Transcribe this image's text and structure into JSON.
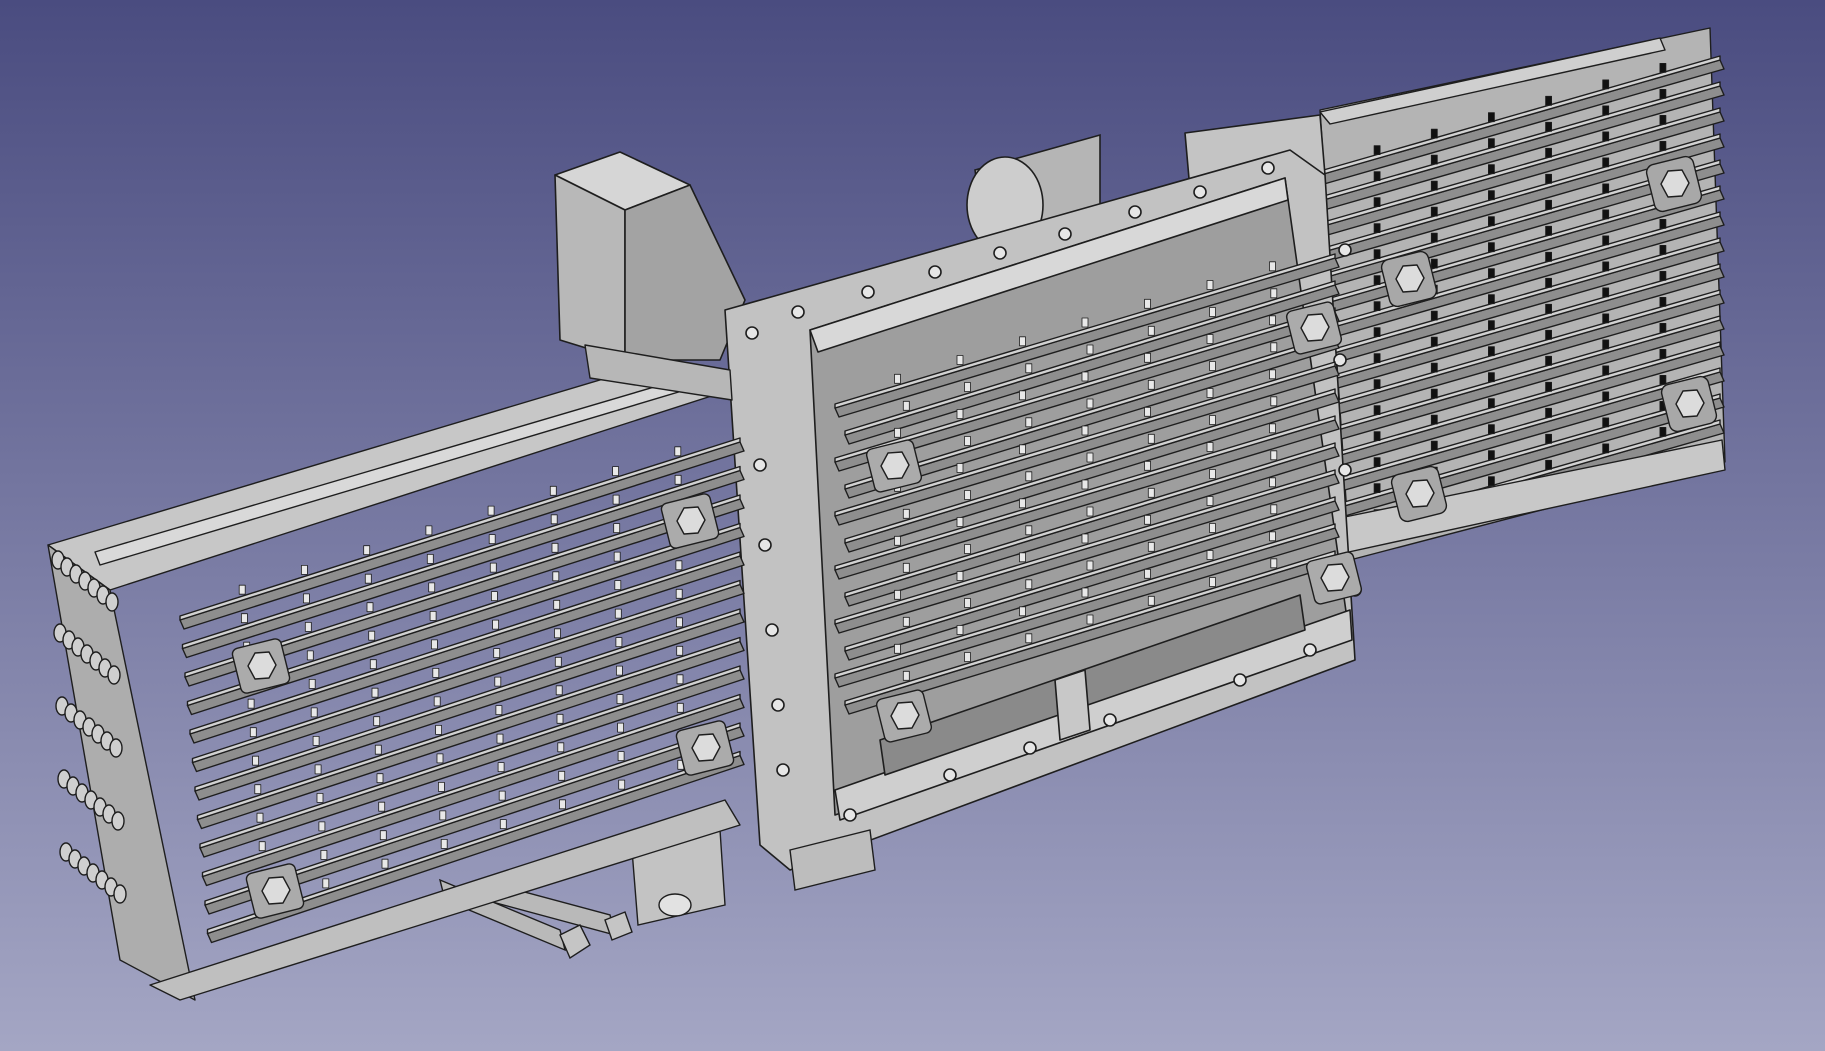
{
  "viewport": {
    "background_top": "#4a4c80",
    "background_bottom": "#a4a6c4",
    "model_fill": "#bdbdbd",
    "model_light": "#d2d2d2",
    "model_dark": "#8e8e8e",
    "edge_color": "#1e1e1e"
  },
  "model": {
    "parts": [
      "left-heatsink-stack",
      "center-heatsink-stack",
      "right-heatsink-stack",
      "mounting-frame",
      "housing-block",
      "cylinder-boss",
      "bottom-rods"
    ],
    "fins_per_stack": 12,
    "bolt_icon": "hex-bolt-icon"
  }
}
